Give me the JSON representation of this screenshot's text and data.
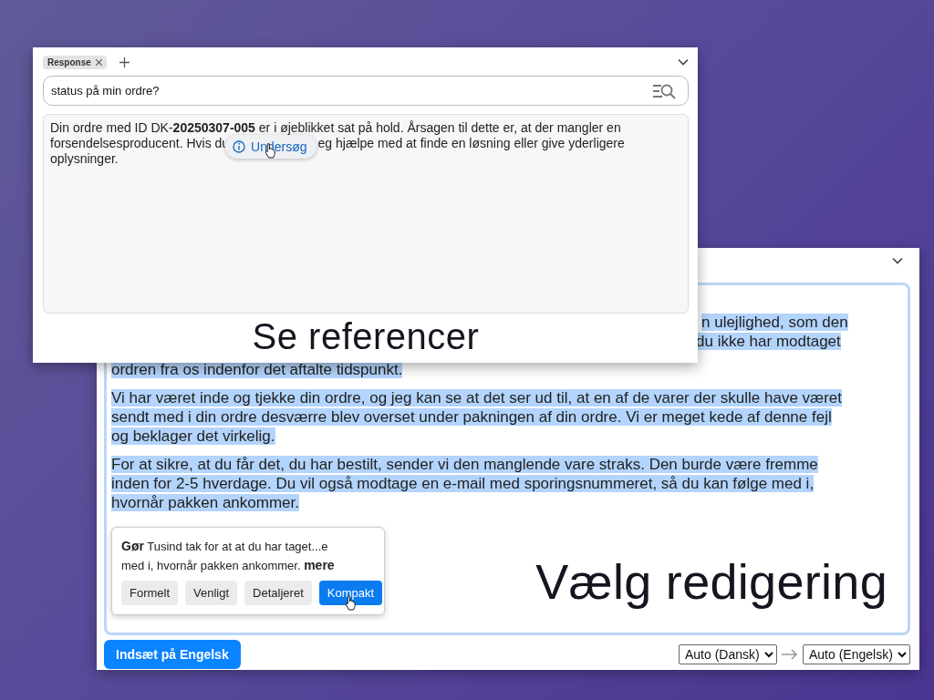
{
  "response_window": {
    "tabs": [
      {
        "label": "Response",
        "selected": true
      }
    ],
    "search": {
      "value": "status på min ordre?"
    },
    "response": {
      "line_1": "Din ordre med ID DK-**20250307-005** er i øjeblikket sat på hold. Årsagen til dette er, at der mangler en",
      "line_2_before": "forsendelsesproducent. Hvis du",
      "tooltip_button": "Undersøg",
      "line_2_after": "eg hjælpe med at finde en løsning eller give yderligere",
      "line_3": "oplysninger."
    },
    "caption": "Se referencer"
  },
  "editor_window": {
    "paragraphs": [
      {
        "kind": "partial",
        "selected": true,
        "lines": [
          "n ulejlighed, som den",
          "du ikke har modtaget",
          "ordren fra os indenfor det aftalte tidspunkt."
        ]
      },
      {
        "kind": "full",
        "selected": true,
        "lines": [
          "Vi har været inde og tjekke din ordre, og jeg kan se at det ser ud til, at en af de varer der skulle have været",
          "sendt med i din ordre desværre blev overset under pakningen af din ordre. Vi er meget kede af denne fejl",
          "og beklager det virkelig."
        ]
      },
      {
        "kind": "full",
        "selected": true,
        "lines": [
          "For at sikre, at du får det, du har bestilt, sender vi den manglende vare straks. Den burde være fremme",
          "inden for 2-5 hverdage. Du vil også modtage en e-mail med sporingsnummeret, så du kan følge med i,",
          "hvornår pakken ankommer."
        ]
      }
    ],
    "suggestion": {
      "lines": [
        "**Gør** Tusind tak for at at du har taget...e",
        "med i, hvornår pakken ankommer. **mere**"
      ],
      "styles": [
        {
          "label": "Formelt",
          "selected": false
        },
        {
          "label": "Venligt",
          "selected": false
        },
        {
          "label": "Detaljeret",
          "selected": false
        },
        {
          "label": "Kompakt",
          "selected": true
        }
      ]
    },
    "caption": "Vælg redigering",
    "insert_button": "Indsæt på Engelsk",
    "source_language": "Auto (Dansk)",
    "target_language": "Auto (Engelsk)"
  }
}
